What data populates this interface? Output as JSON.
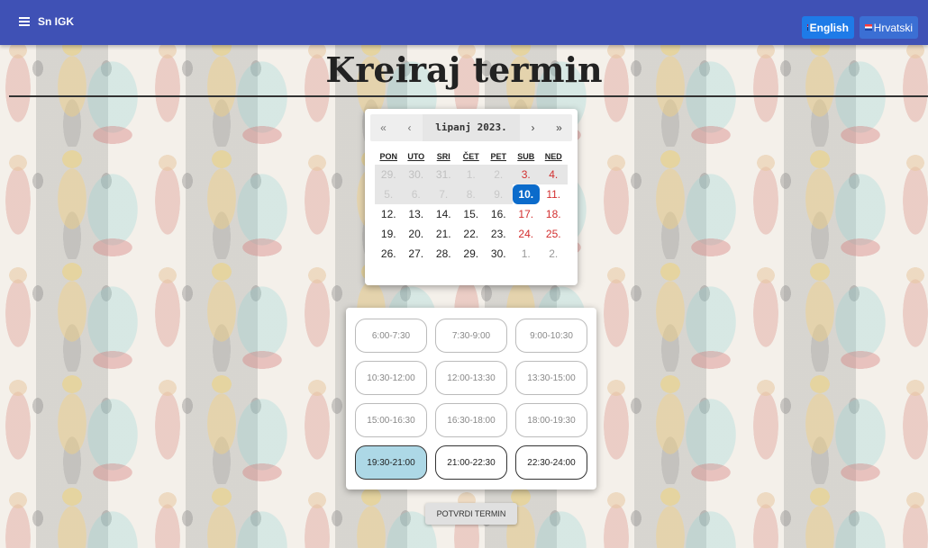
{
  "navbar": {
    "brand": "Sn IGK",
    "lang_en": "English",
    "lang_hr": "Hrvatski",
    "color": "#3f51b5"
  },
  "page_title": "Kreiraj termin",
  "calendar": {
    "nav": {
      "prev_year": "«",
      "prev_month": "‹",
      "next_month": "›",
      "next_year": "»"
    },
    "month_label": "lipanj 2023.",
    "weekdays": [
      "PON",
      "UTO",
      "SRI",
      "ČET",
      "PET",
      "SUB",
      "NED"
    ],
    "days": [
      "29.",
      "30.",
      "31.",
      "1.",
      "2.",
      "3.",
      "4.",
      "5.",
      "6.",
      "7.",
      "8.",
      "9.",
      "10.",
      "11.",
      "12.",
      "13.",
      "14.",
      "15.",
      "16.",
      "17.",
      "18.",
      "19.",
      "20.",
      "21.",
      "22.",
      "23.",
      "24.",
      "25.",
      "26.",
      "27.",
      "28.",
      "29.",
      "30.",
      "1.",
      "2."
    ],
    "selected_day": "10."
  },
  "slots": [
    {
      "label": "6:00-7:30",
      "state": "disabled"
    },
    {
      "label": "7:30-9:00",
      "state": "disabled"
    },
    {
      "label": "9:00-10:30",
      "state": "disabled"
    },
    {
      "label": "10:30-12:00",
      "state": "disabled"
    },
    {
      "label": "12:00-13:30",
      "state": "disabled"
    },
    {
      "label": "13:30-15:00",
      "state": "disabled"
    },
    {
      "label": "15:00-16:30",
      "state": "disabled"
    },
    {
      "label": "16:30-18:00",
      "state": "disabled"
    },
    {
      "label": "18:00-19:30",
      "state": "disabled"
    },
    {
      "label": "19:30-21:00",
      "state": "selected"
    },
    {
      "label": "21:00-22:30",
      "state": "available"
    },
    {
      "label": "22:30-24:00",
      "state": "available"
    }
  ],
  "confirm_label": "POTVRDI TERMIN"
}
